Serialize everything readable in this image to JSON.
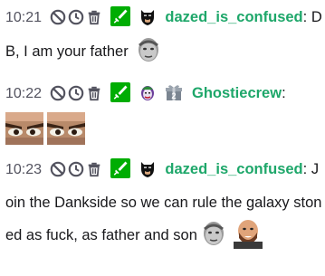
{
  "messages": [
    {
      "timestamp": "10:21",
      "username": "dazed_is_confused",
      "colon": ":",
      "text": "DB, I am your father",
      "badges": [
        "moderator-sword-icon",
        "batman-badge-icon"
      ],
      "emotes": [
        "kappa-face-emote"
      ]
    },
    {
      "timestamp": "10:22",
      "username": "Ghostiecrew",
      "colon": ":",
      "text": "",
      "badges": [
        "moderator-sword-icon",
        "joker-badge-icon",
        "sub-gift-badge-icon"
      ],
      "gift_count": "2",
      "emotes": [
        "angry-eyes-emote",
        "angry-eyes-emote"
      ]
    },
    {
      "timestamp": "10:23",
      "username": "dazed_is_confused",
      "colon": ":",
      "text": "Join the Dankside so we can rule the galaxy stoned as fuck, as father and son",
      "badges": [
        "moderator-sword-icon",
        "batman-badge-icon"
      ],
      "emotes": [
        "kappa-face-emote",
        "bald-man-emote"
      ]
    }
  ],
  "mod_actions": [
    "ban-icon",
    "timeout-icon",
    "delete-icon"
  ],
  "colors": {
    "username": "#1ea76a",
    "mod_badge": "#00ad03",
    "timestamp": "#53535f",
    "text": "#18181b"
  }
}
